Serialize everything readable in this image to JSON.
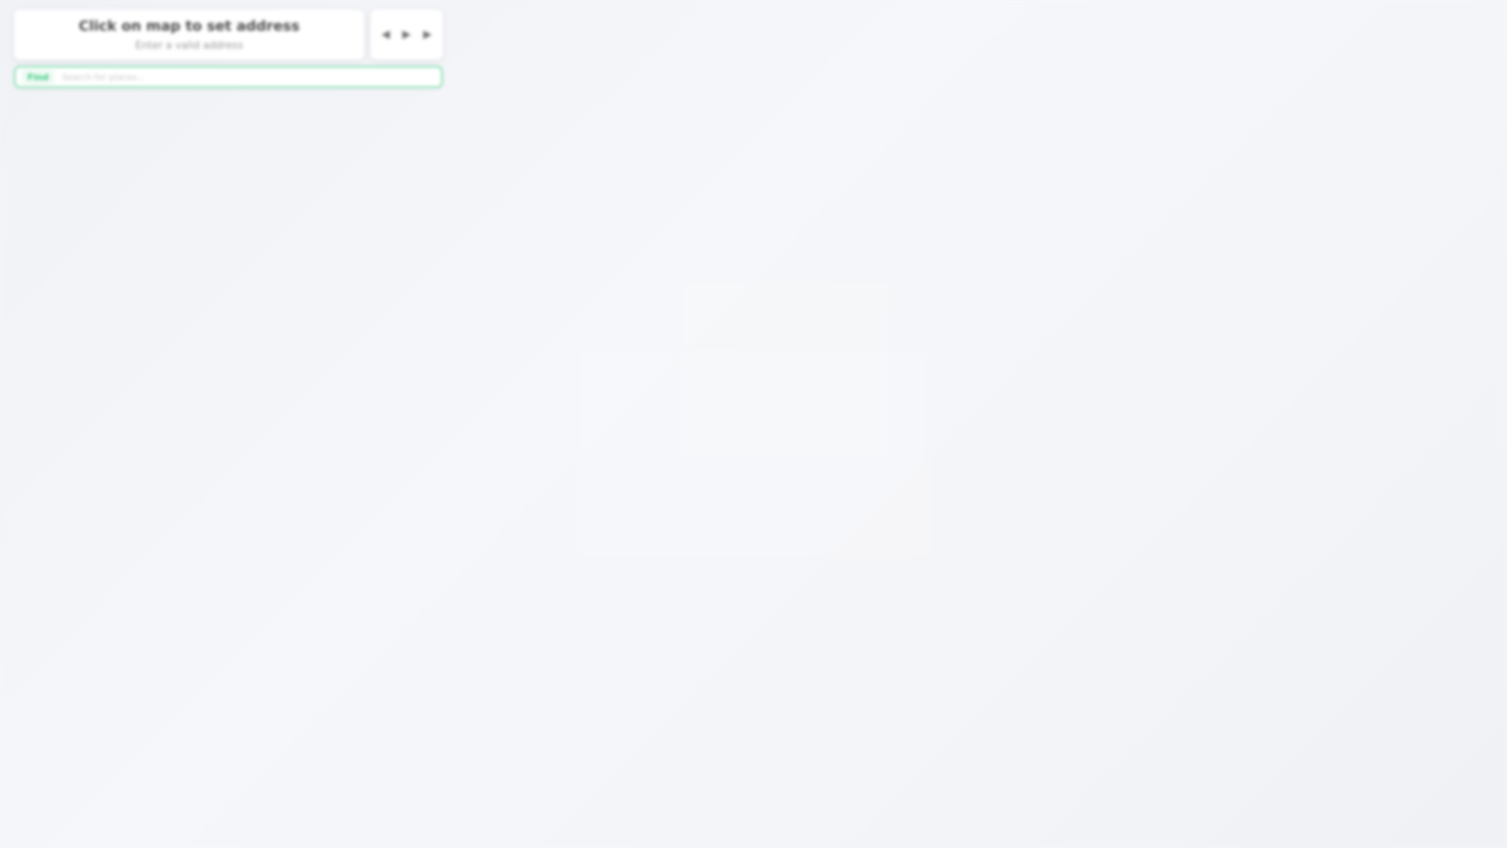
{
  "map": {
    "background_color": "#f4f5f8"
  },
  "address_card": {
    "title": "Click on map to set address",
    "subtitle": "Enter a valid address"
  },
  "navigation": {
    "buttons": [
      {
        "symbol": "◀",
        "icon": "chevron-left-icon"
      },
      {
        "symbol": "▶",
        "icon": "play-icon"
      },
      {
        "symbol": "▶",
        "icon": "next-icon"
      }
    ]
  },
  "search": {
    "tag": "Find",
    "placeholder": "Search for places...",
    "value": "",
    "border_color": "#7fe0ad",
    "tag_color": "#32c97a"
  }
}
